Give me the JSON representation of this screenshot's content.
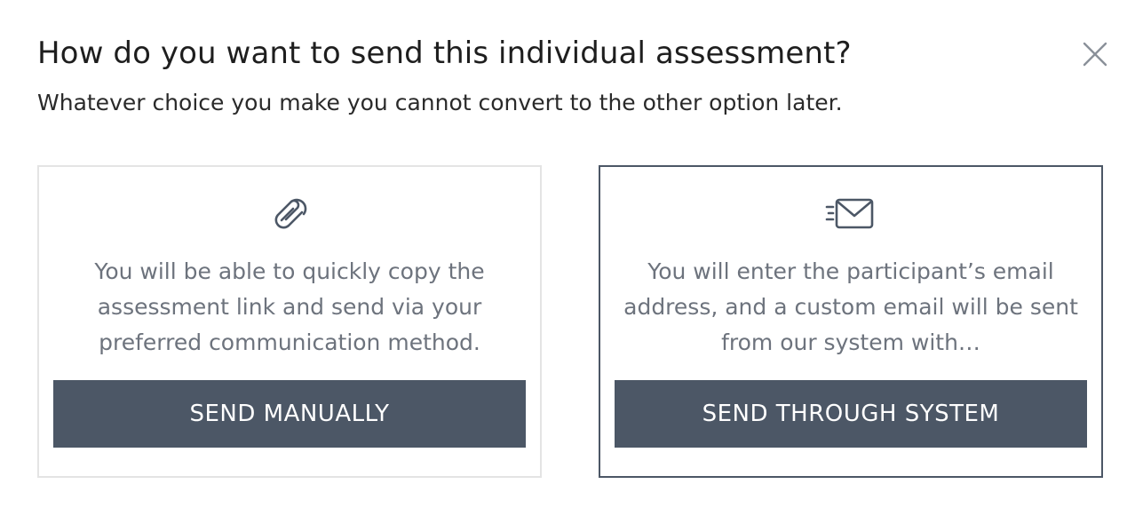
{
  "dialog": {
    "title": "How do you want to send this individual assessment?",
    "subtitle": "Whatever choice you make you cannot convert to the other option later.",
    "close_icon": "close-icon"
  },
  "options": [
    {
      "icon": "link-icon",
      "description": "You will be able to quickly copy the assessment link and send via your preferred communication method.",
      "button_label": "SEND MANUALLY"
    },
    {
      "icon": "fast-email-icon",
      "description": "You will enter the participant’s email address, and a custom email will be sent from our system with…",
      "button_label": "SEND THROUGH SYSTEM"
    }
  ],
  "colors": {
    "button_background": "#4c5766",
    "button_text": "#ffffff",
    "description_text": "#6d737d",
    "selected_border": "#4c5766",
    "default_border": "#e4e4e4"
  }
}
